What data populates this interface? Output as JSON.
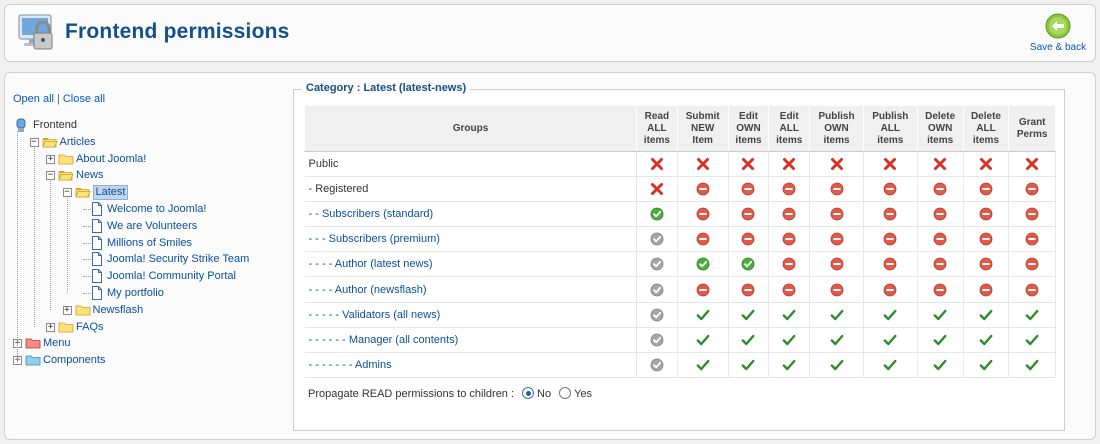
{
  "header": {
    "title": "Frontend permissions",
    "save_label": "Save & back"
  },
  "tree": {
    "open_all": "Open all",
    "close_all": "Close all",
    "separator": "|",
    "nodes": [
      {
        "label": "Frontend",
        "level": 0,
        "type": "root"
      },
      {
        "label": "Articles",
        "level": 1,
        "type": "folder-open",
        "toggle": "−"
      },
      {
        "label": "About Joomla!",
        "level": 2,
        "type": "folder",
        "toggle": "+"
      },
      {
        "label": "News",
        "level": 2,
        "type": "folder-open",
        "toggle": "−"
      },
      {
        "label": "Latest",
        "level": 3,
        "type": "folder-open",
        "toggle": "−",
        "selected": true
      },
      {
        "label": "Welcome to Joomla!",
        "level": 4,
        "type": "page"
      },
      {
        "label": "We are Volunteers",
        "level": 4,
        "type": "page"
      },
      {
        "label": "Millions of Smiles",
        "level": 4,
        "type": "page"
      },
      {
        "label": "Joomla! Security Strike Team",
        "level": 4,
        "type": "page"
      },
      {
        "label": "Joomla! Community Portal",
        "level": 4,
        "type": "page"
      },
      {
        "label": "My portfolio",
        "level": 4,
        "type": "page"
      },
      {
        "label": "Newsflash",
        "level": 3,
        "type": "folder",
        "toggle": "+"
      },
      {
        "label": "FAQs",
        "level": 2,
        "type": "folder",
        "toggle": "+"
      },
      {
        "label": "Menu",
        "level": 0,
        "type": "folder-red",
        "toggle": "+"
      },
      {
        "label": "Components",
        "level": 0,
        "type": "folder-blue",
        "toggle": "+"
      }
    ]
  },
  "category": {
    "legend": "Category : Latest (latest-news)"
  },
  "permissions": {
    "groups_header": "Groups",
    "columns": [
      {
        "line1": "Read",
        "line2": "ALL",
        "line3": "items"
      },
      {
        "line1": "Submit",
        "line2": "NEW",
        "line3": "Item"
      },
      {
        "line1": "Edit",
        "line2": "OWN",
        "line3": "items"
      },
      {
        "line1": "Edit",
        "line2": "ALL",
        "line3": "items"
      },
      {
        "line1": "Publish",
        "line2": "OWN",
        "line3": "items"
      },
      {
        "line1": "Publish",
        "line2": "ALL",
        "line3": "items"
      },
      {
        "line1": "Delete",
        "line2": "OWN",
        "line3": "items"
      },
      {
        "line1": "Delete",
        "line2": "ALL",
        "line3": "items"
      },
      {
        "line1": "Grant",
        "line2": "Perms",
        "line3": ""
      }
    ],
    "rows": [
      {
        "name": "Public",
        "plain": true,
        "cells": [
          "x",
          "x",
          "x",
          "x",
          "x",
          "x",
          "x",
          "x",
          "x"
        ]
      },
      {
        "name": "- Registered",
        "plain": true,
        "cells": [
          "x",
          "no",
          "no",
          "no",
          "no",
          "no",
          "no",
          "no",
          "no"
        ]
      },
      {
        "name": "- - Subscribers (standard)",
        "cells": [
          "ok-green",
          "no",
          "no",
          "no",
          "no",
          "no",
          "no",
          "no",
          "no"
        ]
      },
      {
        "name": "- - - Subscribers (premium)",
        "cells": [
          "ok-grey",
          "no",
          "no",
          "no",
          "no",
          "no",
          "no",
          "no",
          "no"
        ]
      },
      {
        "name": "- - - - Author (latest news)",
        "cells": [
          "ok-grey",
          "ok-green",
          "ok-green",
          "no",
          "no",
          "no",
          "no",
          "no",
          "no"
        ]
      },
      {
        "name": "- - - - Author (newsflash)",
        "cells": [
          "ok-grey",
          "no",
          "no",
          "no",
          "no",
          "no",
          "no",
          "no",
          "no"
        ]
      },
      {
        "name": "- - - - - Validators (all news)",
        "cells": [
          "ok-grey",
          "check",
          "check",
          "check",
          "check",
          "check",
          "check",
          "check",
          "check"
        ]
      },
      {
        "name": "- - - - - - Manager (all contents)",
        "cells": [
          "ok-grey",
          "check",
          "check",
          "check",
          "check",
          "check",
          "check",
          "check",
          "check"
        ]
      },
      {
        "name": "- - - - - - - Admins",
        "cells": [
          "ok-grey",
          "check",
          "check",
          "check",
          "check",
          "check",
          "check",
          "check",
          "check"
        ]
      }
    ]
  },
  "propagate": {
    "label": "Propagate READ permissions to children :",
    "options": [
      "No",
      "Yes"
    ],
    "selected": "No"
  },
  "colors": {
    "title": "#14508c",
    "link": "#0b4f9c",
    "deny_red": "#d93025",
    "inherit_red": "#e05a4a",
    "allow_green": "#4caf3b",
    "check_green": "#2e8b2e",
    "neutral_grey": "#a6a6a6"
  }
}
